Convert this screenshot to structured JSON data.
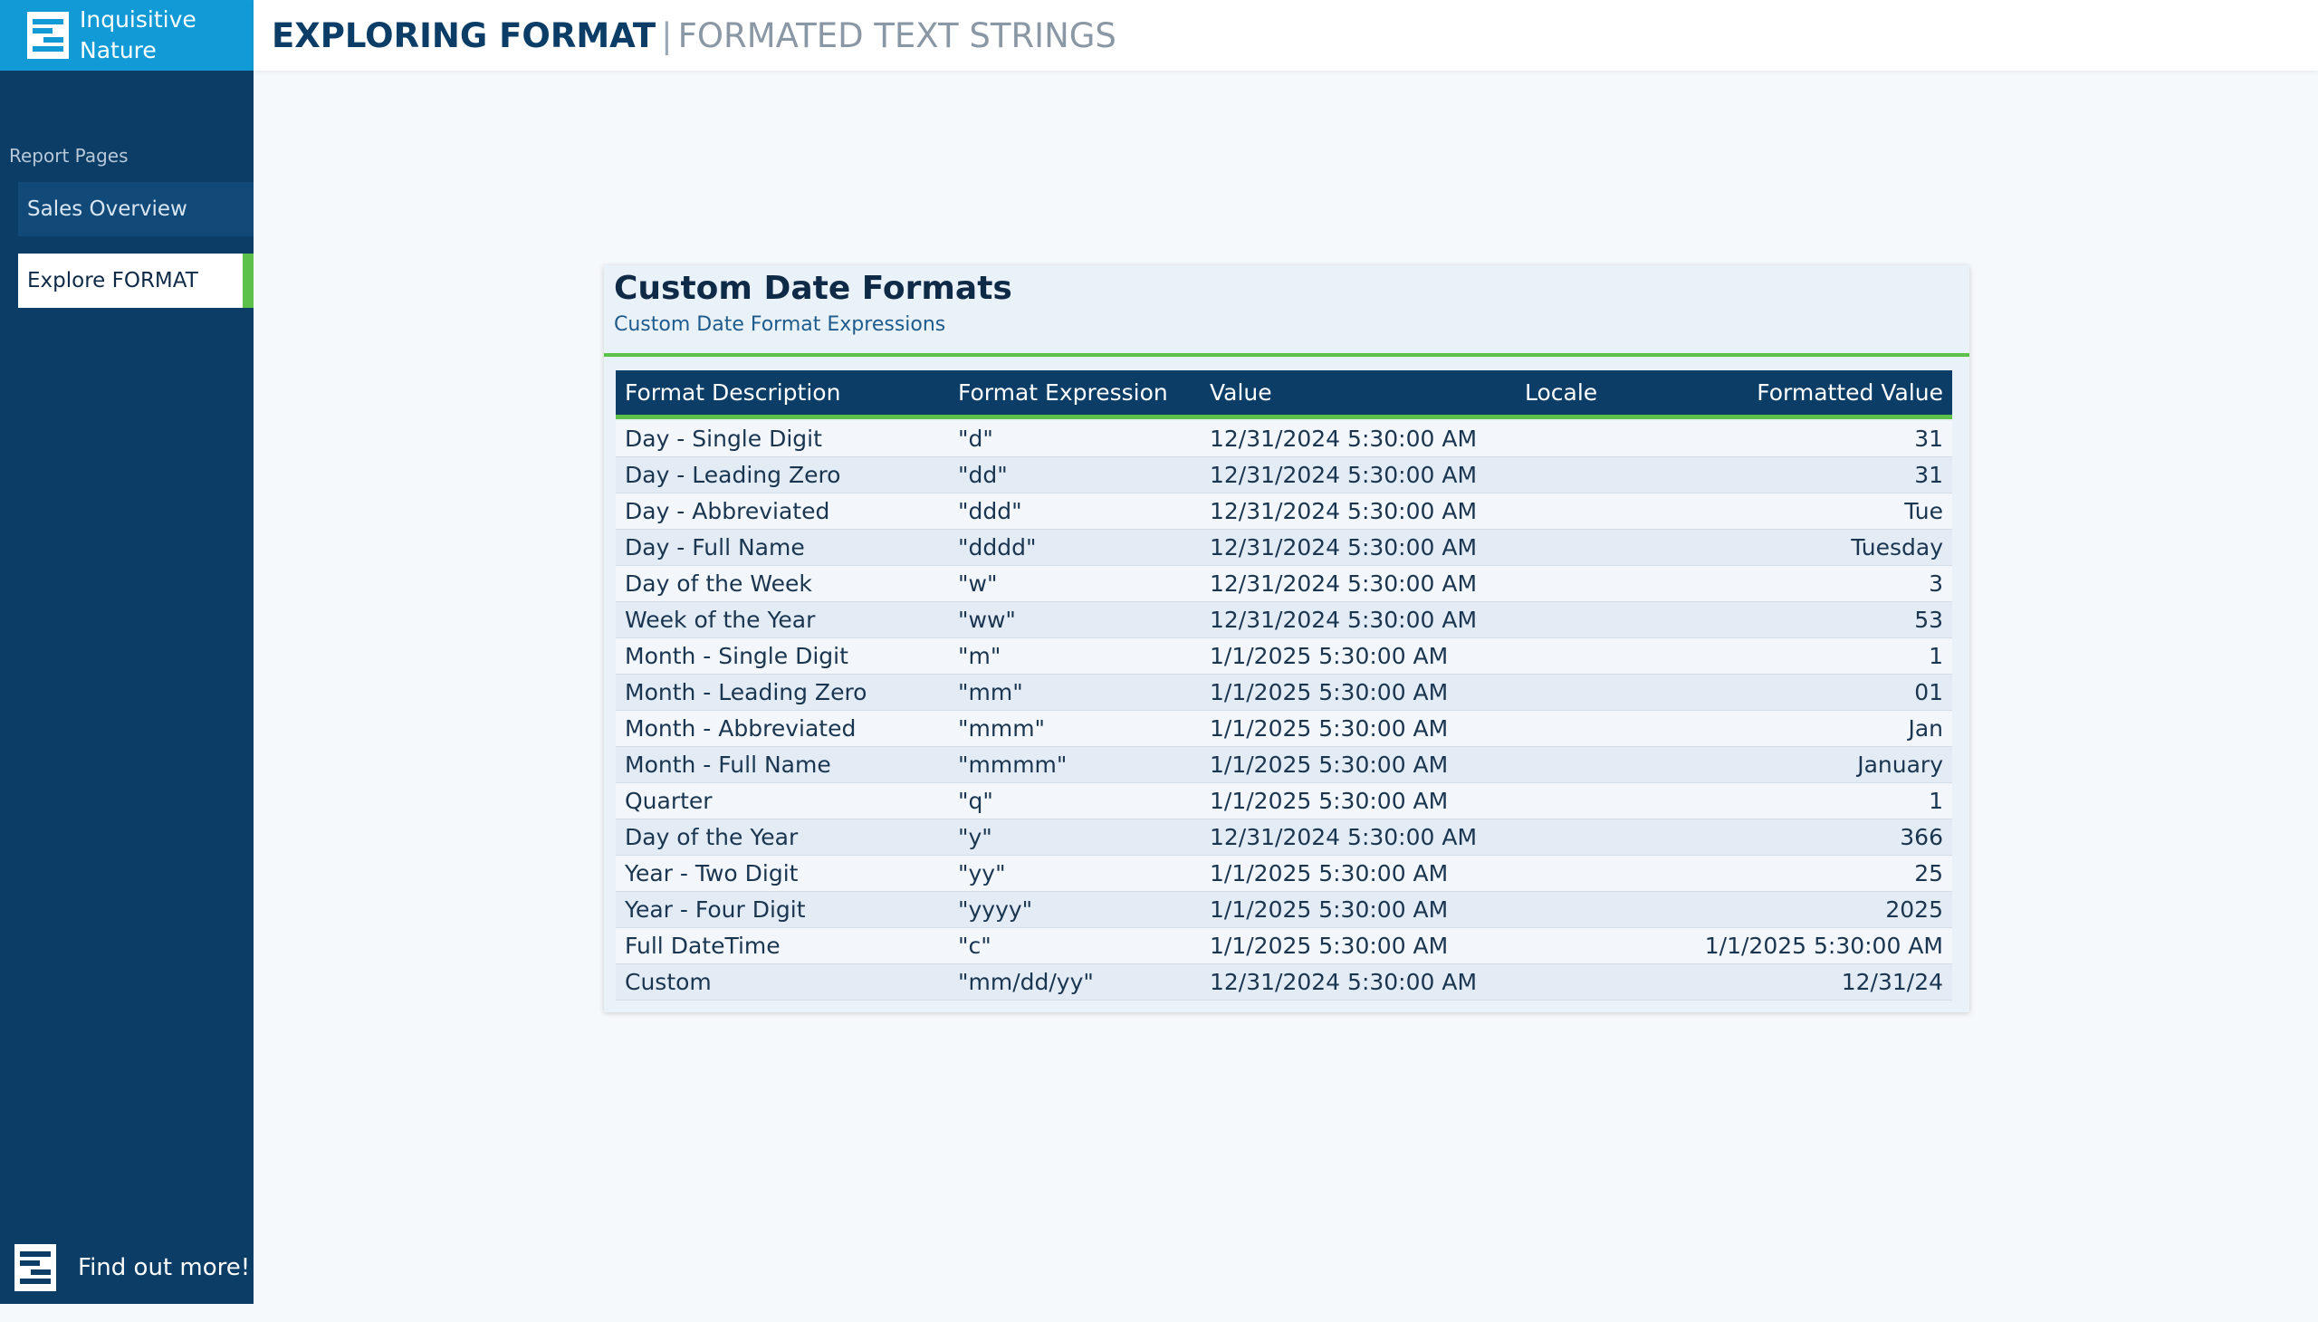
{
  "brand": {
    "line1": "Inquisitive",
    "line2": "Nature"
  },
  "header": {
    "title": "EXPLORING FORMAT",
    "separator": "|",
    "subtitle": "FORMATED TEXT STRINGS"
  },
  "sidebar": {
    "heading": "Report Pages",
    "items": [
      {
        "label": "Sales Overview"
      },
      {
        "label": "Explore FORMAT"
      }
    ],
    "find_more": "Find out more!"
  },
  "card": {
    "title": "Custom Date Formats",
    "subtitle": "Custom Date Format Expressions",
    "columns": [
      "Format Description",
      "Format Expression",
      "Value",
      "Locale",
      "Formatted Value"
    ],
    "rows": [
      [
        "Day - Single Digit",
        "\"d\"",
        "12/31/2024 5:30:00 AM",
        "",
        "31"
      ],
      [
        "Day - Leading Zero",
        "\"dd\"",
        "12/31/2024 5:30:00 AM",
        "",
        "31"
      ],
      [
        "Day - Abbreviated",
        "\"ddd\"",
        "12/31/2024 5:30:00 AM",
        "",
        "Tue"
      ],
      [
        "Day - Full Name",
        "\"dddd\"",
        "12/31/2024 5:30:00 AM",
        "",
        "Tuesday"
      ],
      [
        "Day of the Week",
        "\"w\"",
        "12/31/2024 5:30:00 AM",
        "",
        "3"
      ],
      [
        "Week of the Year",
        "\"ww\"",
        "12/31/2024 5:30:00 AM",
        "",
        "53"
      ],
      [
        "Month - Single Digit",
        "\"m\"",
        "1/1/2025 5:30:00 AM",
        "",
        "1"
      ],
      [
        "Month - Leading Zero",
        "\"mm\"",
        "1/1/2025 5:30:00 AM",
        "",
        "01"
      ],
      [
        "Month - Abbreviated",
        "\"mmm\"",
        "1/1/2025 5:30:00 AM",
        "",
        "Jan"
      ],
      [
        "Month - Full Name",
        "\"mmmm\"",
        "1/1/2025 5:30:00 AM",
        "",
        "January"
      ],
      [
        "Quarter",
        "\"q\"",
        "1/1/2025 5:30:00 AM",
        "",
        "1"
      ],
      [
        "Day of the Year",
        "\"y\"",
        "12/31/2024 5:30:00 AM",
        "",
        "366"
      ],
      [
        "Year - Two Digit",
        "\"yy\"",
        "1/1/2025 5:30:00 AM",
        "",
        "25"
      ],
      [
        "Year - Four Digit",
        "\"yyyy\"",
        "1/1/2025 5:30:00 AM",
        "",
        "2025"
      ],
      [
        "Full DateTime",
        "\"c\"",
        "1/1/2025 5:30:00 AM",
        "",
        "1/1/2025 5:30:00 AM"
      ],
      [
        "Custom",
        "\"mm/dd/yy\"",
        "12/31/2024 5:30:00 AM",
        "",
        "12/31/24"
      ]
    ]
  },
  "colors": {
    "sidebar_bg": "#0b3d66",
    "brand_bg": "#129ad6",
    "accent_green": "#5cc14a",
    "header_title": "#0b3d66"
  }
}
